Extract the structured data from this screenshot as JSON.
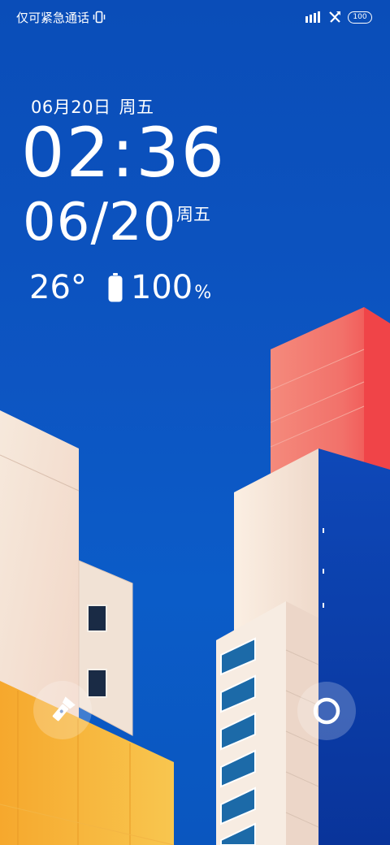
{
  "status_bar": {
    "carrier_text": "仅可紧急通话",
    "icons": [
      "vibrate-icon",
      "signal-icon",
      "no-sim-icon",
      "battery-icon"
    ],
    "battery_level": "100"
  },
  "lockscreen": {
    "small_date": "06月20日",
    "small_weekday": "周五",
    "time": "02:36",
    "big_date": "06/20",
    "big_weekday": "周五",
    "temperature": "26°",
    "battery_value": "100",
    "battery_unit": "%"
  },
  "shortcuts": {
    "left_icon": "flashlight-icon",
    "right_icon": "camera-icon"
  },
  "colors": {
    "sky": "#0d55c2",
    "building_red": "#ee6b63",
    "building_cream": "#f7e6d8",
    "building_yellow": "#f7b23a",
    "building_navy": "#0c3fa8"
  }
}
